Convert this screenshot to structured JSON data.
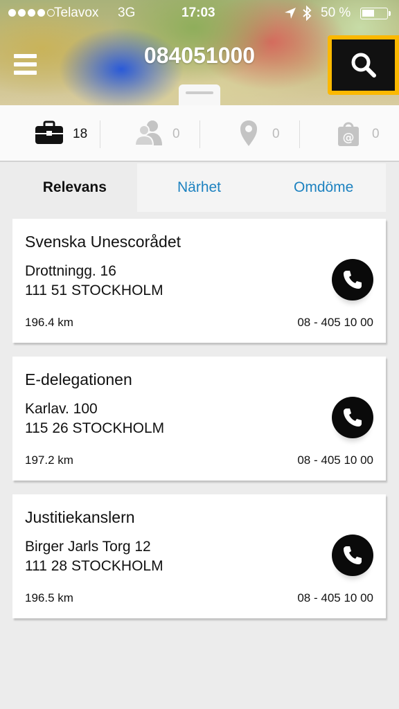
{
  "status_bar": {
    "carrier": "Telavox",
    "network": "3G",
    "time": "17:03",
    "battery_text": "50 %",
    "battery_level": 0.5
  },
  "header": {
    "title": "084051000",
    "menu_icon": "hamburger-menu-icon",
    "search_icon": "magnifier-icon",
    "accent_color": "#fbb800"
  },
  "categories": [
    {
      "icon": "briefcase-icon",
      "count": "18",
      "active": true
    },
    {
      "icon": "people-icon",
      "count": "0",
      "active": false
    },
    {
      "icon": "map-pin-icon",
      "count": "0",
      "active": false
    },
    {
      "icon": "email-bag-icon",
      "count": "0",
      "active": false
    }
  ],
  "sort_tabs": [
    {
      "label": "Relevans",
      "active": true
    },
    {
      "label": "Närhet",
      "active": false
    },
    {
      "label": "Omdöme",
      "active": false
    }
  ],
  "results": [
    {
      "name": "Svenska Unescorådet",
      "street": "Drottningg. 16",
      "city": "111 51 STOCKHOLM",
      "distance": "196.4 km",
      "phone": "08 - 405 10 00"
    },
    {
      "name": "E-delegationen",
      "street": "Karlav. 100",
      "city": "115 26 STOCKHOLM",
      "distance": "197.2 km",
      "phone": "08 - 405 10 00"
    },
    {
      "name": "Justitiekanslern",
      "street": "Birger Jarls Torg 12",
      "city": "111 28 STOCKHOLM",
      "distance": "196.5 km",
      "phone": "08 - 405 10 00"
    }
  ]
}
